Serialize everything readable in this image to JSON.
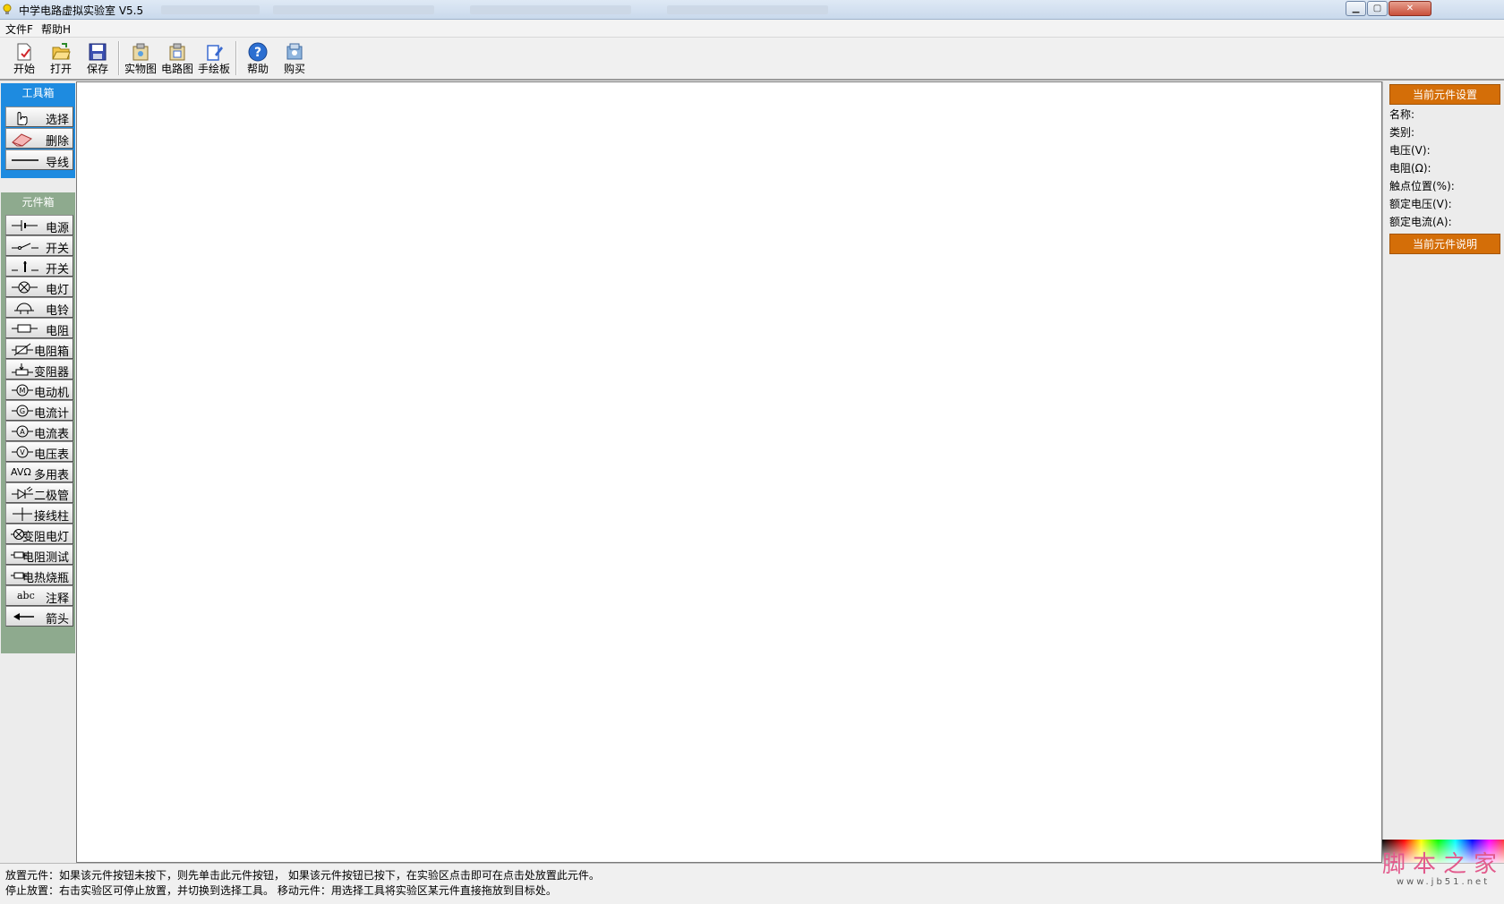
{
  "window": {
    "title": "中学电路虚拟实验室 V5.5",
    "minimize_glyph": "▁",
    "maximize_glyph": "▢",
    "close_glyph": "✕"
  },
  "menu": [
    {
      "label": "文件F"
    },
    {
      "label": "帮助H"
    }
  ],
  "toolbar": [
    {
      "label": "开始",
      "icon": "new-document-icon"
    },
    {
      "label": "打开",
      "icon": "open-folder-icon"
    },
    {
      "label": "保存",
      "icon": "save-disk-icon"
    },
    {
      "label": "实物图",
      "icon": "physical-diagram-icon"
    },
    {
      "label": "电路图",
      "icon": "circuit-diagram-icon"
    },
    {
      "label": "手绘板",
      "icon": "drawing-board-icon"
    },
    {
      "label": "帮助",
      "icon": "help-icon"
    },
    {
      "label": "购买",
      "icon": "buy-icon"
    }
  ],
  "toolbox": {
    "title": "工具箱",
    "items": [
      {
        "label": "选择",
        "icon": "hand-pointer-icon"
      },
      {
        "label": "删除",
        "icon": "eraser-icon"
      },
      {
        "label": "导线",
        "icon": "wire-icon"
      }
    ]
  },
  "components": {
    "title": "元件箱",
    "items": [
      {
        "label": "电源",
        "icon": "battery-symbol-icon"
      },
      {
        "label": "开关",
        "icon": "switch-symbol-icon"
      },
      {
        "label": "开关",
        "icon": "push-switch-symbol-icon"
      },
      {
        "label": "电灯",
        "icon": "lamp-symbol-icon"
      },
      {
        "label": "电铃",
        "icon": "bell-symbol-icon"
      },
      {
        "label": "电阻",
        "icon": "resistor-symbol-icon"
      },
      {
        "label": "电阻箱",
        "icon": "resistor-box-symbol-icon"
      },
      {
        "label": "变阻器",
        "icon": "rheostat-symbol-icon"
      },
      {
        "label": "电动机",
        "icon": "motor-symbol-icon"
      },
      {
        "label": "电流计",
        "icon": "galvanometer-symbol-icon"
      },
      {
        "label": "电流表",
        "icon": "ammeter-symbol-icon"
      },
      {
        "label": "电压表",
        "icon": "voltmeter-symbol-icon"
      },
      {
        "label": "多用表",
        "icon": "multimeter-symbol-icon",
        "prefix": "AVΩ"
      },
      {
        "label": "二极管",
        "icon": "diode-symbol-icon"
      },
      {
        "label": "接线柱",
        "icon": "terminal-symbol-icon"
      },
      {
        "label": "变阻电灯",
        "icon": "variable-lamp-symbol-icon"
      },
      {
        "label": "电阻测试",
        "icon": "resistance-test-symbol-icon"
      },
      {
        "label": "电热烧瓶",
        "icon": "heating-flask-symbol-icon"
      },
      {
        "label": "注释",
        "icon": "annotation-icon",
        "prefix": "abc"
      },
      {
        "label": "箭头",
        "icon": "arrow-left-icon"
      }
    ]
  },
  "properties": {
    "settings_title": "当前元件设置",
    "fields": [
      {
        "label": "名称:"
      },
      {
        "label": "类别:"
      },
      {
        "label": "电压(V):"
      },
      {
        "label": "电阻(Ω):"
      },
      {
        "label": "触点位置(%):"
      },
      {
        "label": "额定电压(V):"
      },
      {
        "label": "额定电流(A):"
      }
    ],
    "description_title": "当前元件说明"
  },
  "status": {
    "line1": "放置元件：如果该元件按钮未按下，则先单击此元件按钮， 如果该元件按钮已按下，在实验区点击即可在点击处放置此元件。",
    "line2": "停止放置：右击实验区可停止放置，并切换到选择工具。 移动元件：用选择工具将实验区某元件直接拖放到目标处。"
  },
  "watermark": {
    "text": "脚本之家",
    "url": "www.jb51.net"
  },
  "colors": {
    "toolbox_bg": "#1e8be0",
    "components_bg": "#8eaa8e",
    "property_header": "#d46e08"
  }
}
